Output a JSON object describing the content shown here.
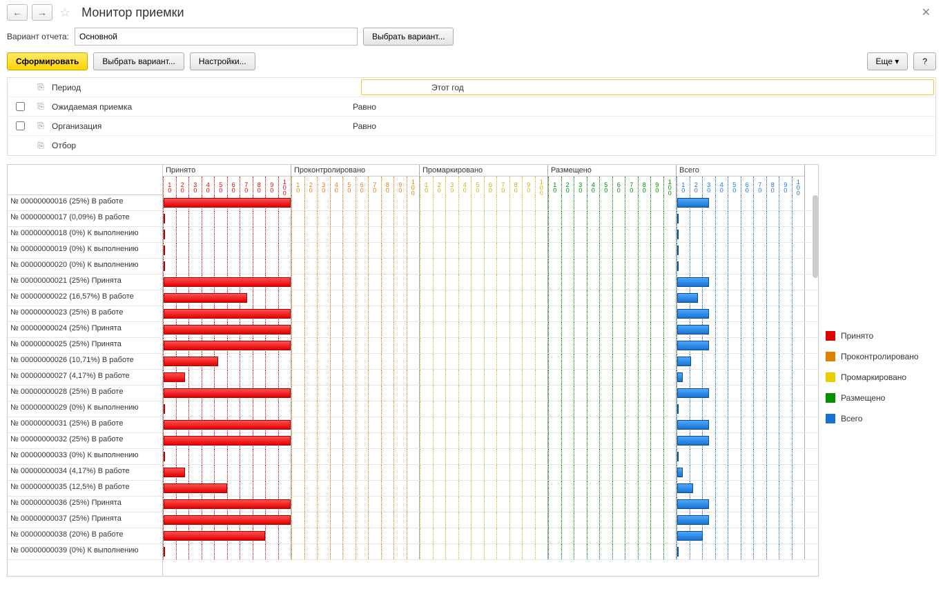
{
  "header": {
    "title": "Монитор приемки"
  },
  "variant": {
    "label": "Вариант отчета:",
    "value": "Основной",
    "choose_btn": "Выбрать вариант..."
  },
  "toolbar": {
    "form": "Сформировать",
    "choose": "Выбрать вариант...",
    "settings": "Настройки...",
    "more": "Еще",
    "help": "?"
  },
  "filters": [
    {
      "check": null,
      "name": "Период",
      "cond": "",
      "val": "Этот год",
      "highlight": true
    },
    {
      "check": false,
      "name": "Ожидаемая приемка",
      "cond": "Равно",
      "val": ""
    },
    {
      "check": false,
      "name": "Организация",
      "cond": "Равно",
      "val": ""
    },
    {
      "check": null,
      "name": "Отбор",
      "cond": "",
      "val": ""
    }
  ],
  "chart_data": {
    "type": "bar",
    "groups": [
      {
        "name": "Принято",
        "color": "red",
        "ticks": [
          10,
          20,
          30,
          40,
          50,
          60,
          70,
          80,
          90,
          100
        ]
      },
      {
        "name": "Проконтролировано",
        "color": "orange",
        "ticks": [
          10,
          20,
          30,
          40,
          50,
          60,
          70,
          80,
          90,
          100
        ]
      },
      {
        "name": "Промаркировано",
        "color": "yellow",
        "ticks": [
          10,
          20,
          30,
          40,
          50,
          60,
          70,
          80,
          90,
          100
        ]
      },
      {
        "name": "Размещено",
        "color": "green",
        "ticks": [
          10,
          20,
          30,
          40,
          50,
          60,
          70,
          80,
          90,
          100
        ]
      },
      {
        "name": "Всего",
        "color": "blue",
        "ticks": [
          10,
          20,
          30,
          40,
          50,
          60,
          70,
          80,
          90,
          100
        ]
      }
    ],
    "rows": [
      {
        "label": "№ 00000000016 (25%) В работе",
        "accepted": 100,
        "total": 25
      },
      {
        "label": "№ 00000000017 (0,09%) В работе",
        "accepted": 0.36,
        "total": 0.09
      },
      {
        "label": "№ 00000000018 (0%) К выполнению",
        "accepted": 0,
        "total": 0
      },
      {
        "label": "№ 00000000019 (0%) К выполнению",
        "accepted": 0,
        "total": 0
      },
      {
        "label": "№ 00000000020 (0%) К выполнению",
        "accepted": 0,
        "total": 0
      },
      {
        "label": "№ 00000000021 (25%) Принята",
        "accepted": 100,
        "total": 25
      },
      {
        "label": "№ 00000000022 (16,57%) В работе",
        "accepted": 66,
        "total": 16.57
      },
      {
        "label": "№ 00000000023 (25%) В работе",
        "accepted": 100,
        "total": 25
      },
      {
        "label": "№ 00000000024 (25%) Принята",
        "accepted": 100,
        "total": 25
      },
      {
        "label": "№ 00000000025 (25%) Принята",
        "accepted": 100,
        "total": 25
      },
      {
        "label": "№ 00000000026 (10,71%) В работе",
        "accepted": 43,
        "total": 10.71
      },
      {
        "label": "№ 00000000027 (4,17%) В работе",
        "accepted": 17,
        "total": 4.17
      },
      {
        "label": "№ 00000000028 (25%) В работе",
        "accepted": 100,
        "total": 25
      },
      {
        "label": "№ 00000000029 (0%) К выполнению",
        "accepted": 0,
        "total": 0
      },
      {
        "label": "№ 00000000031 (25%) В работе",
        "accepted": 100,
        "total": 25
      },
      {
        "label": "№ 00000000032 (25%) В работе",
        "accepted": 100,
        "total": 25
      },
      {
        "label": "№ 00000000033 (0%) К выполнению",
        "accepted": 0,
        "total": 0
      },
      {
        "label": "№ 00000000034 (4,17%) В работе",
        "accepted": 17,
        "total": 4.17
      },
      {
        "label": "№ 00000000035 (12,5%) В работе",
        "accepted": 50,
        "total": 12.5
      },
      {
        "label": "№ 00000000036 (25%) Принята",
        "accepted": 100,
        "total": 25
      },
      {
        "label": "№ 00000000037 (25%) Принята",
        "accepted": 100,
        "total": 25
      },
      {
        "label": "№ 00000000038 (20%) В работе",
        "accepted": 80,
        "total": 20
      },
      {
        "label": "№ 00000000039 (0%) К выполнению",
        "accepted": 0,
        "total": 0
      }
    ],
    "legend": [
      "Принято",
      "Проконтролировано",
      "Промаркировано",
      "Размещено",
      "Всего"
    ],
    "legend_colors": [
      "#e00000",
      "#e08000",
      "#e8d000",
      "#009000",
      "#1873d0"
    ]
  }
}
